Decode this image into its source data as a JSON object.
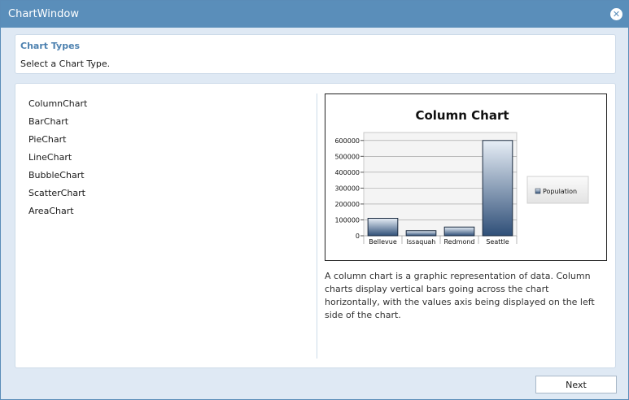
{
  "window": {
    "title": "ChartWindow"
  },
  "header": {
    "heading": "Chart Types",
    "subheading": "Select a Chart Type."
  },
  "chart_types": [
    "ColumnChart",
    "BarChart",
    "PieChart",
    "LineChart",
    "BubbleChart",
    "ScatterChart",
    "AreaChart"
  ],
  "description": "A column chart is a graphic representation of data. Column charts display vertical bars going across the chart horizontally, with the values axis being displayed on the left side of the chart.",
  "footer": {
    "next_label": "Next"
  },
  "colors": {
    "titlebar": "#5a8eba",
    "accent": "#4e82b0",
    "bar_top": "#e7eef6",
    "bar_bottom": "#2f4f78"
  },
  "chart_data": {
    "type": "bar",
    "title": "Column Chart",
    "categories": [
      "Bellevue",
      "Issaquah",
      "Redmond",
      "Seattle"
    ],
    "series": [
      {
        "name": "Population",
        "values": [
          110000,
          32000,
          55000,
          600000
        ]
      }
    ],
    "yticks": [
      "0",
      "100000",
      "200000",
      "300000",
      "400000",
      "500000",
      "600000"
    ],
    "ylim": [
      0,
      650000
    ],
    "legend": "right",
    "grid": true
  }
}
